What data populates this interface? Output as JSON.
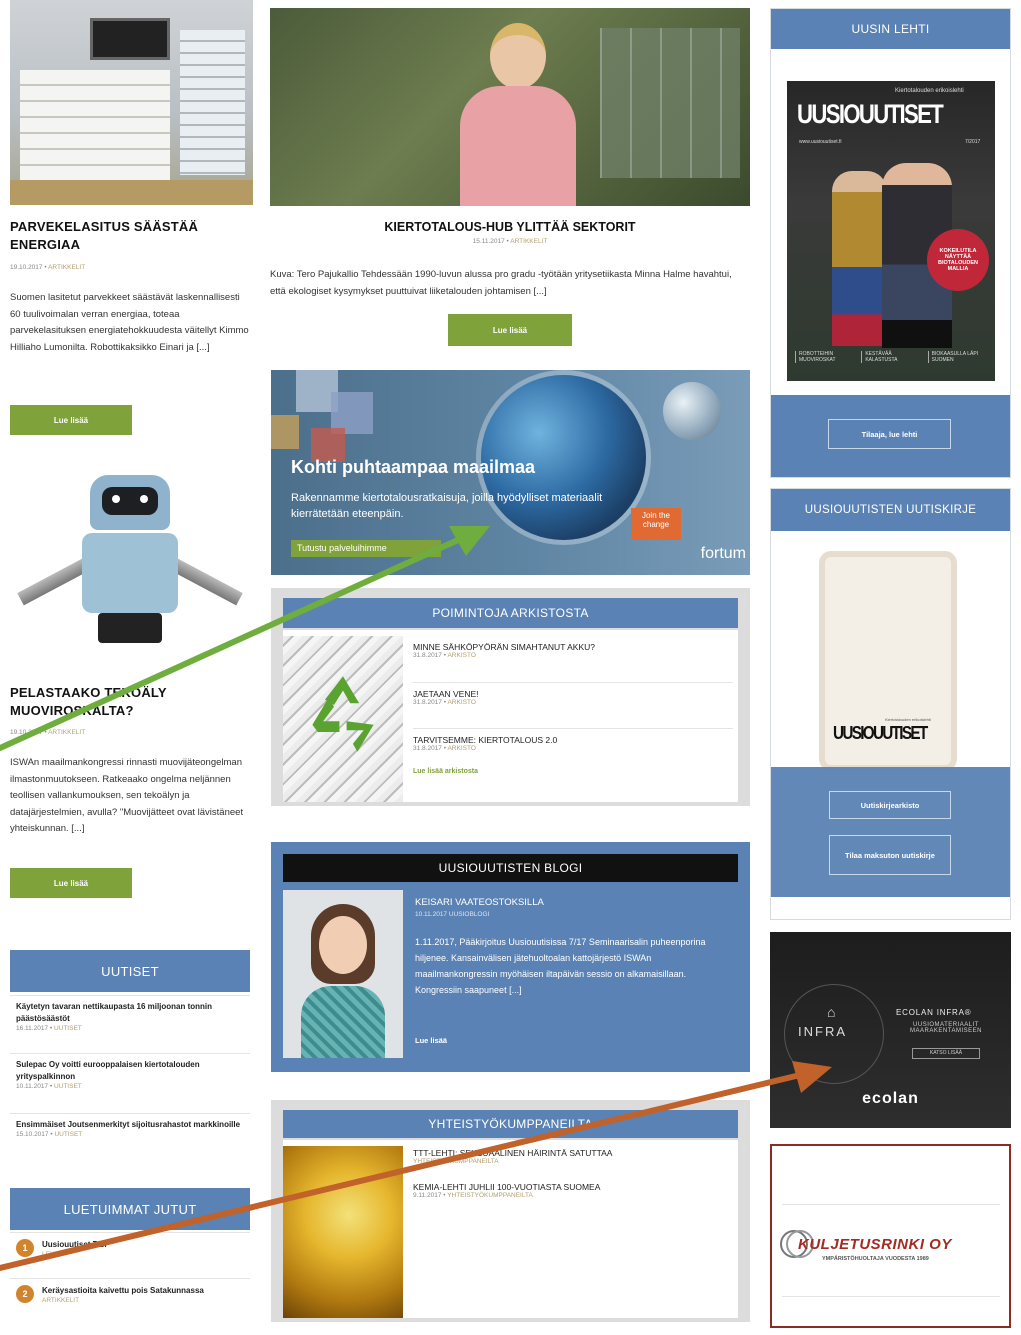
{
  "left": {
    "article1": {
      "title": "PARVEKELASITUS SÄÄSTÄÄ ENERGIAA",
      "date": "19.10.2017",
      "category": "ARTIKKELIT",
      "excerpt": "Suomen lasitetut parvekkeet säästävät laskennallisesti 60 tuulivoimalan verran energiaa, toteaa parvekelasituksen energiatehokkuudesta väitellyt Kimmo Hilliaho Lumonilta.   Robottikaksikko Einari ja [...]",
      "read_more": "Lue lisää"
    },
    "article2": {
      "title": "PELASTAAKO TEKOÄLY MUOVIROSKALTA?",
      "date": "19.10.2017",
      "category": "ARTIKKELIT",
      "excerpt": "ISWAn maailmankongressi rinnasti muovijäteongelman ilmastonmuutokseen. Ratkeaako ongelma neljännen teollisen vallankumouksen, sen tekoälyn ja datajärjestelmien, avulla?   \"Muovijätteet ovat lävistäneet yhteiskunnan. [...]",
      "read_more": "Lue lisää"
    },
    "uutiset": {
      "header": "UUTISET",
      "items": [
        {
          "title": "Käytetyn tavaran nettikaupasta 16 miljoonan tonnin päästösäästöt",
          "date": "16.11.2017",
          "category": "UUTISET"
        },
        {
          "title": "Sulepac Oy voitti eurooppalaisen kiertotalouden yrityspalkinnon",
          "date": "10.11.2017",
          "category": "UUTISET"
        },
        {
          "title": "Ensimmäiset Joutsenmerkityt sijoitusrahastot markkinoille",
          "date": "15.10.2017",
          "category": "UUTISET"
        }
      ]
    },
    "luetuimmat": {
      "header": "LUETUIMMAT JUTUT",
      "items": [
        {
          "num": "1",
          "title": "Uusiouutiset 7/17",
          "category": "LEHTI"
        },
        {
          "num": "2",
          "title": "Keräysastioita kaivettu pois Satakunnassa",
          "category": "ARTIKKELIT"
        }
      ]
    }
  },
  "center": {
    "featured": {
      "title": "KIERTOTALOUS-HUB YLITTÄÄ SEKTORIT",
      "date": "15.11.2017",
      "category": "ARTIKKELIT",
      "excerpt": "Kuva: Tero Pajukallio   Tehdessään 1990-luvun alussa pro gradu -työtään yritysetiikasta Minna Halme havahtui, että ekologiset kysymykset puuttuivat liiketalouden johtamisen [...]",
      "read_more": "Lue lisää"
    },
    "fortum_ad": {
      "headline": "Kohti puhtaampaa maailmaa",
      "subtext": "Rakennamme kiertotalousratkaisuja, joilla hyödylliset materiaalit kierrätetään eteenpäin.",
      "cta": "Tutustu palveluihimme",
      "join": "Join the change",
      "brand": "fortum"
    },
    "archive": {
      "header": "POIMINTOJA ARKISTOSTA",
      "items": [
        {
          "title": "MINNE SÄHKÖPYÖRÄN SIMAHTANUT AKKU?",
          "date": "31.8.2017",
          "category": "ARKISTO"
        },
        {
          "title": "JAETAAN VENE!",
          "date": "31.8.2017",
          "category": "ARKISTO"
        },
        {
          "title": "TARVITSEMME: KIERTOTALOUS 2.0",
          "date": "31.8.2017",
          "category": "ARKISTO"
        }
      ],
      "more": "Lue lisää arkistosta"
    },
    "blog": {
      "header": "UUSIOUUTISTEN BLOGI",
      "title": "KEISARI VAATEOSTOKSILLA",
      "date": "10.11.2017",
      "category": "UUSIOBLOGI",
      "excerpt": "1.11.2017, Pääkirjoitus Uusiouutisissa 7/17   Seminaarisalin puheenporina hiljenee. Kansainvälisen jätehuoltoalan kattojärjestö ISWAn maailmankongressin myöhäisen iltapäivän sessio on alkamaisillaan. Kongressiin saapuneet [...]",
      "more": "Lue lisää"
    },
    "partners": {
      "header": "YHTEISTYÖKUMPPANEILTA",
      "items": [
        {
          "title": "TTT-LEHTI: SEKSUAALINEN HÄIRINTÄ SATUTTAA",
          "date": "",
          "category": "YHTEISTYÖKUMPPANEILTA"
        },
        {
          "title": "KEMIA-LEHTI JUHLII 100-VUOTIASTA SUOMEA",
          "date": "9.11.2017",
          "category": "YHTEISTYÖKUMPPANEILTA"
        }
      ]
    }
  },
  "right": {
    "uusin_lehti": {
      "header": "UUSIN LEHTI",
      "cover_logo": "UUSIOUUTISET",
      "cover_tagline": "Kiertotalouden erikoislehti",
      "cover_url": "www.uusiouutiset.fi",
      "cover_issue": "7/2017",
      "cover_badge": "KOKEILUTILA NÄYTTÄÄ BIOTALOUDEN MALLIA",
      "cover_footer": [
        "ROBOTTEIHIN MUOVIROSKAT",
        "KESTÄVÄÄ KALASTUSTA",
        "BIOKAASULLA LÄPI SUOMEN"
      ],
      "button": "Tilaaja, lue lehti"
    },
    "newsletter": {
      "header": "UUSIOUUTISTEN UUTISKIRJE",
      "tablet_logo": "UUSIOUUTISET",
      "tablet_tagline": "Kiertotalouden erikoislehti",
      "btn1": "Uutiskirjearkisto",
      "btn2": "Tilaa maksuton uutiskirje"
    },
    "ecolan_ad": {
      "infra": "INFRA",
      "title": "ECOLAN INFRA®",
      "sub": "UUSIOMATERIAALIT MAARAKENTAMISEEN",
      "cta": "KATSO LISÄÄ",
      "brand": "ecolan"
    },
    "kuljetus_ad": {
      "name": "KULJETUSRINKI OY",
      "tagline": "YMPÄRISTÖHUOLTAJA VUODESTA 1989"
    }
  },
  "colors": {
    "section_blue": "#5a82b4",
    "button_green": "#7fa23a",
    "arrow_green": "#6fae3e",
    "arrow_orange": "#c0622a"
  }
}
